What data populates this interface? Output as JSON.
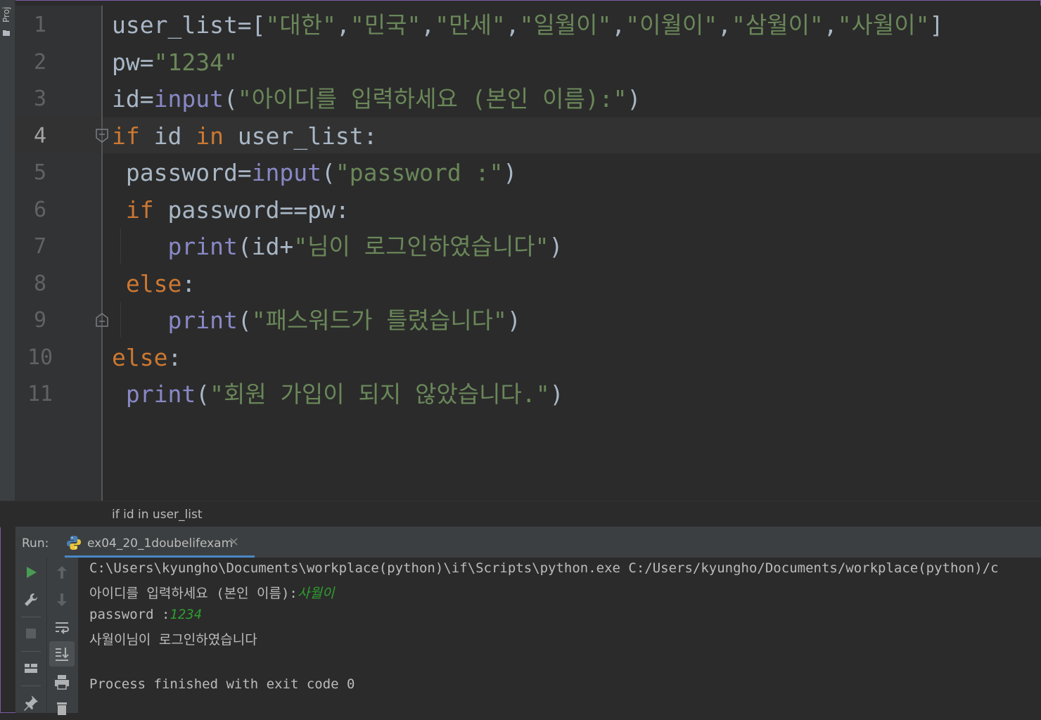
{
  "sidebar": {
    "project_label": "Proj"
  },
  "editor": {
    "lines": [
      {
        "n": "1",
        "t": [
          [
            "p",
            "user_list=["
          ],
          [
            "s",
            "\"대한\""
          ],
          [
            "p",
            ","
          ],
          [
            "s",
            "\"민국\""
          ],
          [
            "p",
            ","
          ],
          [
            "s",
            "\"만세\""
          ],
          [
            "p",
            ","
          ],
          [
            "s",
            "\"일월이\""
          ],
          [
            "p",
            ","
          ],
          [
            "s",
            "\"이월이\""
          ],
          [
            "p",
            ","
          ],
          [
            "s",
            "\"삼월이\""
          ],
          [
            "p",
            ","
          ],
          [
            "s",
            "\"사월이\""
          ],
          [
            "p",
            "]"
          ]
        ]
      },
      {
        "n": "2",
        "t": [
          [
            "p",
            "pw="
          ],
          [
            "s",
            "\"1234\""
          ]
        ]
      },
      {
        "n": "3",
        "t": [
          [
            "p",
            "id="
          ],
          [
            "b",
            "input"
          ],
          [
            "p",
            "("
          ],
          [
            "s",
            "\"아이디를 입력하세요 (본인 이름):\""
          ],
          [
            "p",
            ")"
          ]
        ]
      },
      {
        "n": "4",
        "t": [
          [
            "k",
            "if"
          ],
          [
            "p",
            " id "
          ],
          [
            "k",
            "in"
          ],
          [
            "p",
            " user_list:"
          ]
        ]
      },
      {
        "n": "5",
        "t": [
          [
            "p",
            " password="
          ],
          [
            "b",
            "input"
          ],
          [
            "p",
            "("
          ],
          [
            "s",
            "\"password :\""
          ],
          [
            "p",
            ")"
          ]
        ]
      },
      {
        "n": "6",
        "t": [
          [
            "p",
            " "
          ],
          [
            "k",
            "if"
          ],
          [
            "p",
            " password==pw:"
          ]
        ]
      },
      {
        "n": "7",
        "t": [
          [
            "p",
            "    "
          ],
          [
            "b",
            "print"
          ],
          [
            "p",
            "(id+"
          ],
          [
            "s",
            "\"님이 로그인하였습니다\""
          ],
          [
            "p",
            ")"
          ]
        ]
      },
      {
        "n": "8",
        "t": [
          [
            "p",
            " "
          ],
          [
            "k",
            "else"
          ],
          [
            "p",
            ":"
          ]
        ]
      },
      {
        "n": "9",
        "t": [
          [
            "p",
            "    "
          ],
          [
            "b",
            "print"
          ],
          [
            "p",
            "("
          ],
          [
            "s",
            "\"패스워드가 틀렸습니다\""
          ],
          [
            "p",
            ")"
          ]
        ]
      },
      {
        "n": "10",
        "t": [
          [
            "k",
            "else"
          ],
          [
            "p",
            ":"
          ]
        ]
      },
      {
        "n": "11",
        "t": [
          [
            "p",
            " "
          ],
          [
            "b",
            "print"
          ],
          [
            "p",
            "("
          ],
          [
            "s",
            "\"회원 가입이 되지 않았습니다.\""
          ],
          [
            "p",
            ")"
          ]
        ]
      }
    ],
    "active_line": "4"
  },
  "breadcrumb": "if id in user_list",
  "run": {
    "label": "Run:",
    "tab_name": "ex04_20_1doubelifexam",
    "close_glyph": "×",
    "console": {
      "command": "C:\\Users\\kyungho\\Documents\\workplace(python)\\if\\Scripts\\python.exe C:/Users/kyungho/Documents/workplace(python)/c",
      "prompt1": "아이디를 입력하세요 (본인 이름):",
      "input1": "사월이",
      "prompt2": "password :",
      "input2": "1234",
      "result": "사월이님이 로그인하였습니다",
      "exit": "Process finished with exit code 0"
    }
  },
  "colors": {
    "keyword": "#cc7832",
    "builtin": "#8888c6",
    "string": "#6a8759",
    "plain": "#a9b7c6",
    "user_input": "#2f9e2f",
    "background": "#2b2b2b"
  }
}
